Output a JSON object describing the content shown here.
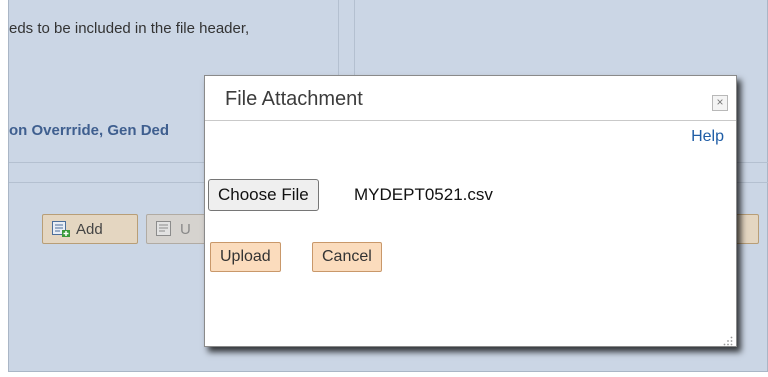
{
  "background": {
    "fragment_text": "eds to be included in the file header,",
    "fragment_bold": "on Overrride, Gen Ded",
    "add_button_label": "Add",
    "second_button_label": "U"
  },
  "modal": {
    "title": "File Attachment",
    "close_glyph": "×",
    "help_link": "Help",
    "choose_file_label": "Choose File",
    "file_name": "MYDEPT0521.csv",
    "upload_label": "Upload",
    "cancel_label": "Cancel"
  },
  "icons": {
    "close": "close-icon",
    "add": "add-icon",
    "upload": "upload-icon",
    "resize": "resize-grip-icon"
  },
  "colors": {
    "accent_button": "#fbdcbd",
    "link": "#1f5da6",
    "mask": "#cbd6e5"
  }
}
